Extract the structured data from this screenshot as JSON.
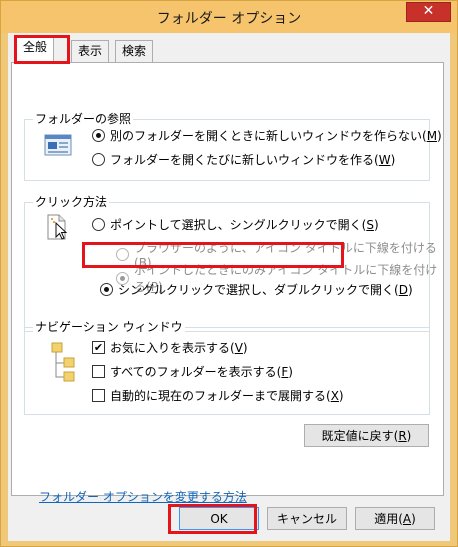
{
  "window": {
    "title": "フォルダー オプション",
    "close_glyph": "✕"
  },
  "tabs": [
    {
      "label": "全般",
      "active": true
    },
    {
      "label": "表示",
      "active": false
    },
    {
      "label": "検索",
      "active": false
    }
  ],
  "browse_folders": {
    "label": "フォルダーの参照",
    "options": [
      {
        "text": "別のフォルダーを開くときに新しいウィンドウを作らない(",
        "key": "M",
        "end": ")",
        "checked": true
      },
      {
        "text": "フォルダーを開くたびに新しいウィンドウを作る(",
        "key": "W",
        "end": ")",
        "checked": false
      }
    ]
  },
  "click_method": {
    "label": "クリック方法",
    "single": {
      "text": "ポイントして選択し、シングルクリックで開く(",
      "key": "S",
      "end": ")",
      "checked": false
    },
    "sub_options": [
      {
        "text": "ブラウザーのように、アイコン タイトルに下線を付ける(",
        "key": "B",
        "end": ")",
        "checked": false
      },
      {
        "text": "ポイントしたときにのみアイコン タイトルに下線を付ける(",
        "key": "P",
        "end": ")",
        "checked": true
      }
    ],
    "double": {
      "text": "シングルクリックで選択し、ダブルクリックで開く(",
      "key": "D",
      "end": ")",
      "checked": true
    }
  },
  "navigation_pane": {
    "label": "ナビゲーション ウィンドウ",
    "options": [
      {
        "text": "お気に入りを表示する(",
        "key": "V",
        "end": ")",
        "checked": true
      },
      {
        "text": "すべてのフォルダーを表示する(",
        "key": "F",
        "end": ")",
        "checked": false
      },
      {
        "text": "自動的に現在のフォルダーまで展開する(",
        "key": "X",
        "end": ")",
        "checked": false
      }
    ]
  },
  "restore_defaults": {
    "text": "既定値に戻す(",
    "key": "R",
    "end": ")"
  },
  "help_link": "フォルダー オプションを変更する方法",
  "buttons": {
    "ok": "OK",
    "cancel": "キャンセル",
    "apply_text": "適用(",
    "apply_key": "A",
    "apply_end": ")"
  },
  "colors": {
    "title_bar": "#f5c46d",
    "highlight": "#e3151b",
    "link": "#1166bb"
  }
}
